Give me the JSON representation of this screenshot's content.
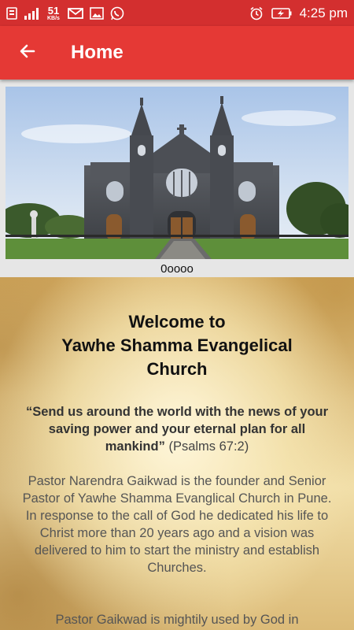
{
  "status_bar": {
    "speed_value": "51",
    "speed_unit": "KB/s",
    "time": "4:25 pm",
    "icons": [
      "notification-icon",
      "signal-icon",
      "mail-icon",
      "image-icon",
      "whatsapp-icon",
      "alarm-icon",
      "battery-charging-icon"
    ]
  },
  "app_bar": {
    "title": "Home",
    "background": "#e53935",
    "status_color": "#d32f2f"
  },
  "slider": {
    "caption": "0oooo",
    "image": "church-photo"
  },
  "content": {
    "title_line1": "Welcome to",
    "title_line2": "Yawhe Shamma Evangelical",
    "title_line3": "Church",
    "quote_text": "“Send us around the world with the news of your saving power and your eternal plan for all mankind”",
    "quote_ref": "(Psalms 67:2)",
    "paragraph1": "Pastor Narendra Gaikwad is the founder and Senior Pastor of Yawhe Shamma Evanglical Church in Pune. In response to the call of God he dedicated his life to Christ more than 20 years ago and a vision was delivered to him to start the ministry and establish Churches.",
    "paragraph2": "Pastor Gaikwad is mightily used by God in"
  }
}
